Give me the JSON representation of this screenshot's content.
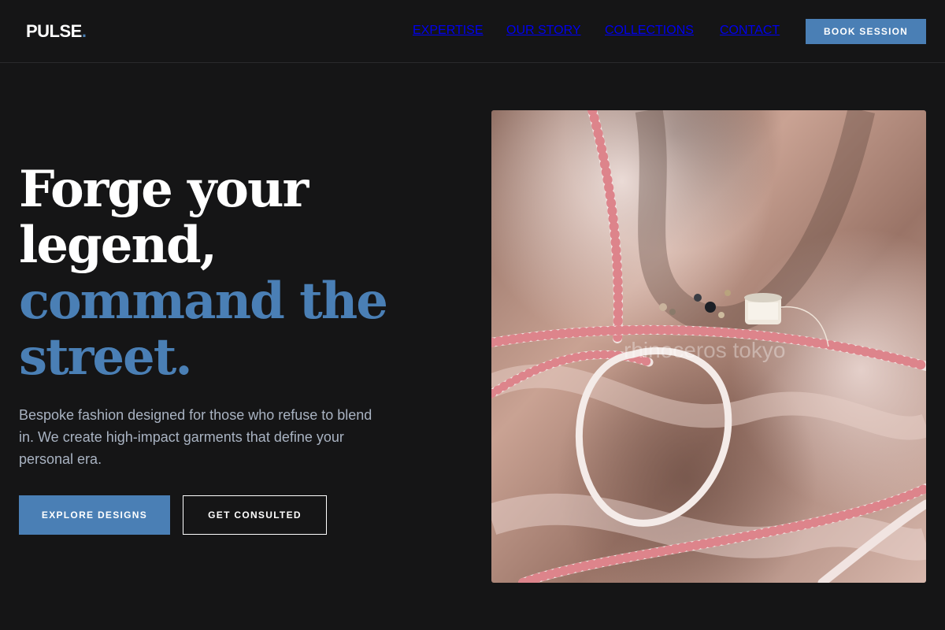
{
  "brand": {
    "name": "PULSE",
    "dot": ".",
    "accent_color": "#4a7fb5"
  },
  "nav": {
    "items": [
      {
        "label": "EXPERTISE"
      },
      {
        "label": "OUR STORY"
      },
      {
        "label": "COLLECTIONS"
      },
      {
        "label": "CONTACT"
      }
    ],
    "cta_label": "BOOK SESSION"
  },
  "hero": {
    "headline_line1": "Forge your",
    "headline_line2": "legend,",
    "headline_accent_line1": "command the",
    "headline_accent_line2": "street.",
    "subtitle": "Bespoke fashion designed for those who refuse to blend in. We create high-impact garments that define your personal era.",
    "primary_button": "EXPLORE DESIGNS",
    "secondary_button": "GET CONSULTED",
    "image": {
      "subject": "satin-fabric-with-measuring-tape",
      "watermark": "rhinoceros tokyo"
    }
  },
  "colors": {
    "background": "#151516",
    "accent": "#4a7fb5",
    "text": "#ffffff",
    "muted_text": "#a9b3c2"
  }
}
